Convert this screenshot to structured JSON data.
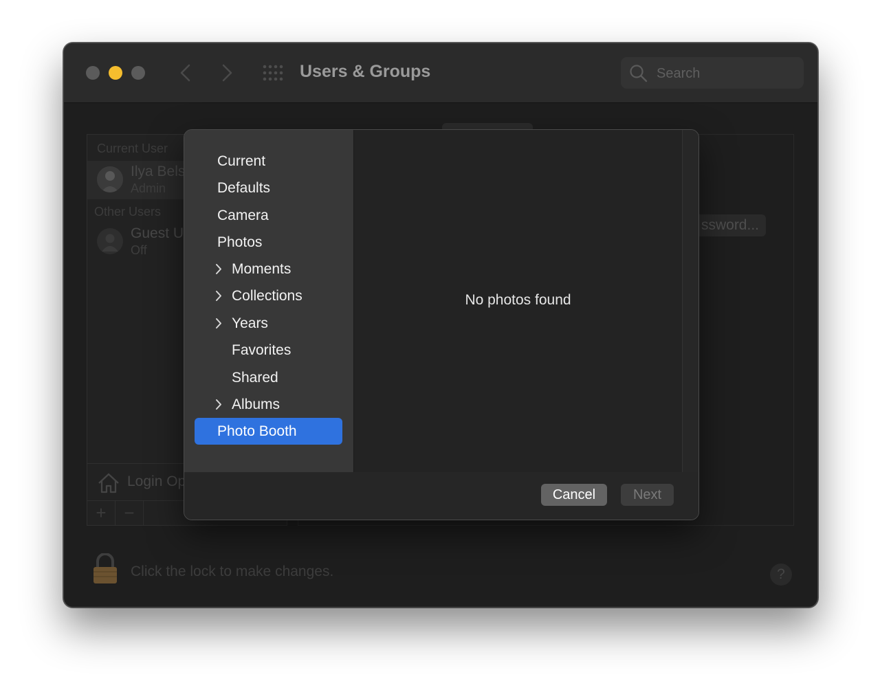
{
  "window": {
    "title": "Users & Groups",
    "search_placeholder": "Search"
  },
  "users_panel": {
    "current_user_label": "Current User",
    "current_user": {
      "name": "Ilya Bels",
      "role": "Admin"
    },
    "other_users_label": "Other Users",
    "guest_user": {
      "name": "Guest U",
      "status": "Off"
    },
    "login_options_label": "Login Op",
    "add_symbol": "+",
    "remove_symbol": "−"
  },
  "right_panel": {
    "password_button_label": "ssword..."
  },
  "footer": {
    "lock_text": "Click the lock to make changes.",
    "help_symbol": "?"
  },
  "dialog": {
    "sources": [
      {
        "label": "Current",
        "expandable": false
      },
      {
        "label": "Defaults",
        "expandable": false
      },
      {
        "label": "Camera",
        "expandable": false
      },
      {
        "label": "Photos",
        "expandable": false
      },
      {
        "label": "Moments",
        "expandable": true
      },
      {
        "label": "Collections",
        "expandable": true
      },
      {
        "label": "Years",
        "expandable": true
      },
      {
        "label": "Favorites",
        "expandable": false
      },
      {
        "label": "Shared",
        "expandable": false
      },
      {
        "label": "Albums",
        "expandable": true
      },
      {
        "label": "Photo Booth",
        "expandable": false,
        "selected": true
      }
    ],
    "empty_message": "No photos found",
    "cancel_label": "Cancel",
    "next_label": "Next",
    "selection_color": "#2f72df"
  },
  "icons": {
    "traffic_close": "close-button",
    "traffic_minimize": "minimize-button",
    "traffic_maximize": "zoom-button",
    "back": "chevron-left-icon",
    "forward": "chevron-right-icon",
    "grid": "show-all-grid-icon",
    "search": "magnifier-icon",
    "house": "house-icon",
    "lock": "lock-icon",
    "disclosure": "chevron-right-icon"
  },
  "colors": {
    "minimize_yellow": "#f5bd2e",
    "accent_blue": "#2f72df",
    "lock_gold": "#8a6a35"
  }
}
